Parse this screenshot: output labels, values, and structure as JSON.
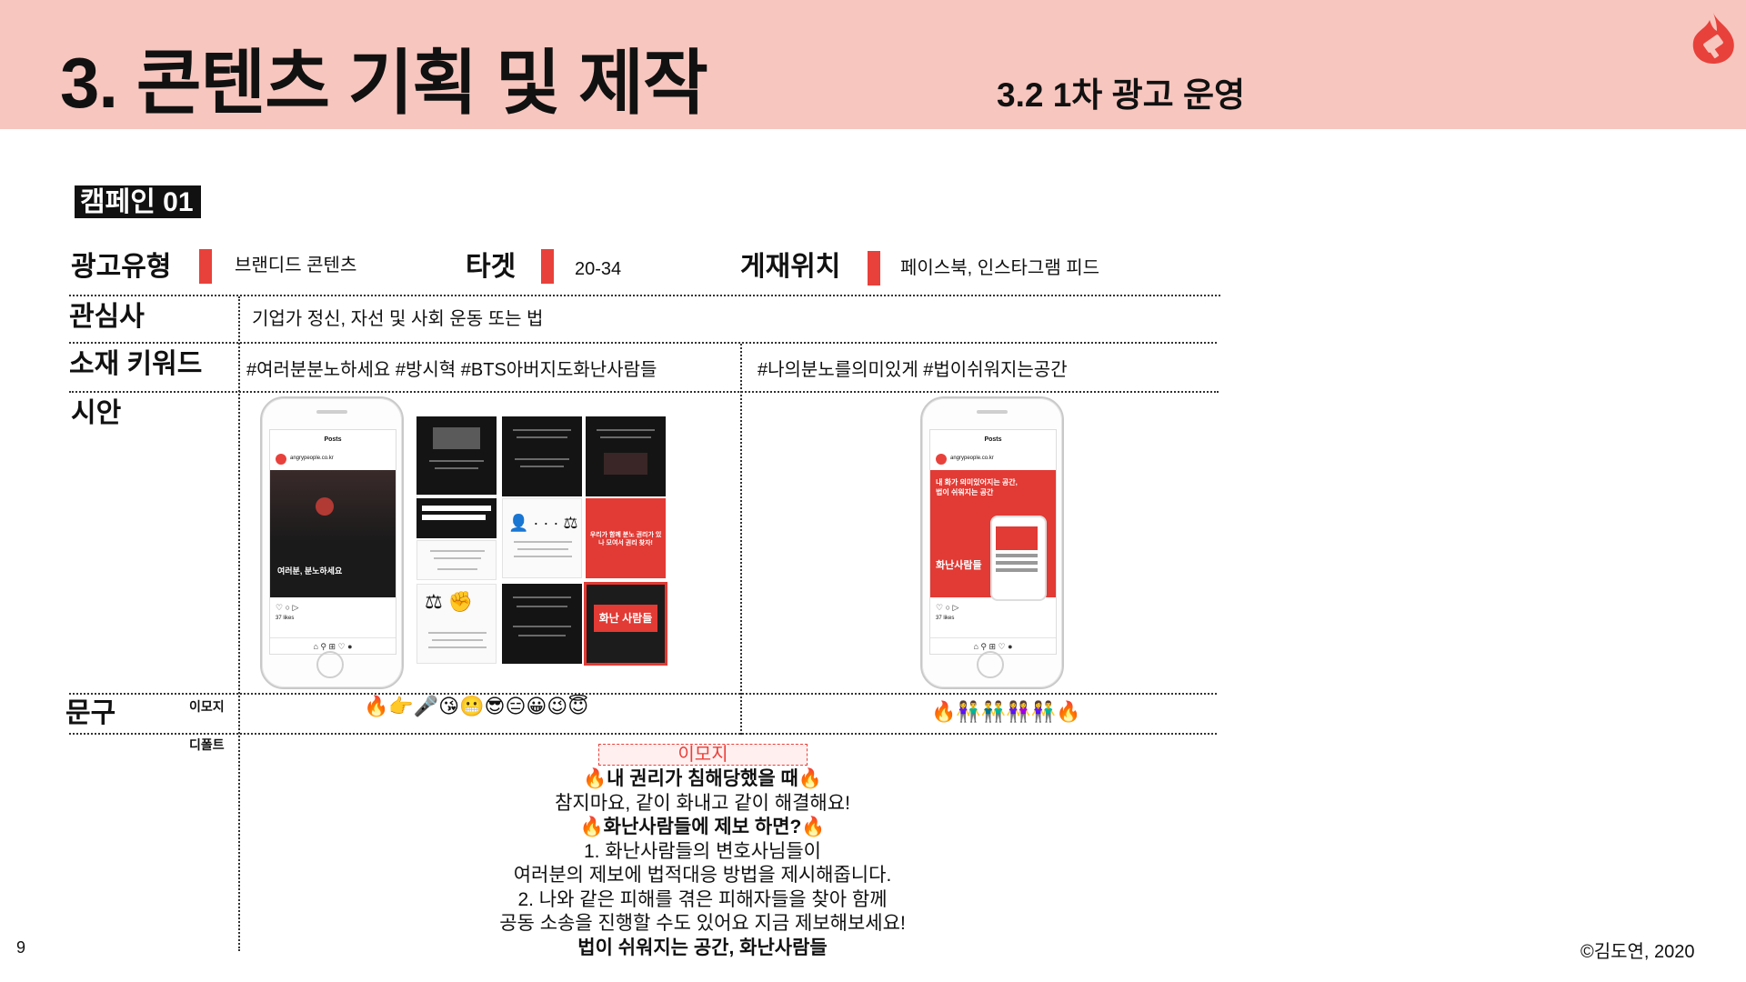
{
  "header": {
    "title": "3. 콘텐츠 기획 및 제작",
    "subtitle": "3.2  1차 광고 운영",
    "logo_icon": "flame-logo-icon"
  },
  "campaign": {
    "label": "캠페인 01"
  },
  "info": {
    "ad_type_label": "광고유형",
    "ad_type_value": "브랜디드 콘텐츠",
    "target_label": "타겟",
    "target_value": "20-34",
    "placement_label": "게재위치",
    "placement_value": "페이스북, 인스타그램 피드"
  },
  "rows": {
    "interest_label": "관심사",
    "interest_value": "기업가 정신, 자선 및 사회 운동 또는 법",
    "keyword_label": "소재 키워드",
    "keywords_left": "#여러분분노하세요 #방시혁  #BTS아버지도화난사람들",
    "keywords_right": "#나의분노를의미있게   #법이쉬워지는공간",
    "mockup_label": "시안",
    "copy_label": "문구",
    "emoji_label": "이모지",
    "default_label": "디폴트"
  },
  "mockups": {
    "left_phone": {
      "account": "angrypeople.co.kr",
      "header": "Posts",
      "headline": "여러분, 분노하세요",
      "likes": "37 likes"
    },
    "right_phone": {
      "account": "angrypeople.co.kr",
      "header": "Posts",
      "headline": "내 화가 의미있어지는 공간, 법이 쉬워지는 공간",
      "inner_headline": "화난사람들",
      "likes": "37 likes"
    },
    "grid_texts": {
      "red_tile": "우리가 함께 분노 권리가 있나 모여서 권리 찾자!",
      "final_tile": "화난 사람들"
    }
  },
  "emojis": {
    "left": "🔥👉🎤😘😬😎😑😀😉😇",
    "right": "🔥👫👬👭👫🔥"
  },
  "copy_text": {
    "tag": "이모지",
    "line1": "🔥내 권리가 침해당했을 때🔥",
    "line2": "참지마요, 같이 화내고 같이 해결해요!",
    "line3": "🔥화난사람들에 제보 하면?🔥",
    "line4": "1. 화난사람들의 변호사님들이",
    "line5": "여러분의 제보에 법적대응 방법을 제시해줍니다.",
    "line6": "2. 나와 같은 피해를 겪은 피해자들을 찾아 함께",
    "line7": "공동 소송을 진행할 수도 있어요 지금 제보해보세요!",
    "line8": "법이 쉬워지는 공간, 화난사람들"
  },
  "footer": {
    "page_number": "9",
    "copyright": "©김도연, 2020"
  },
  "colors": {
    "header_bg": "#f7c6bf",
    "accent_red": "#e8413b",
    "text": "#111111"
  }
}
